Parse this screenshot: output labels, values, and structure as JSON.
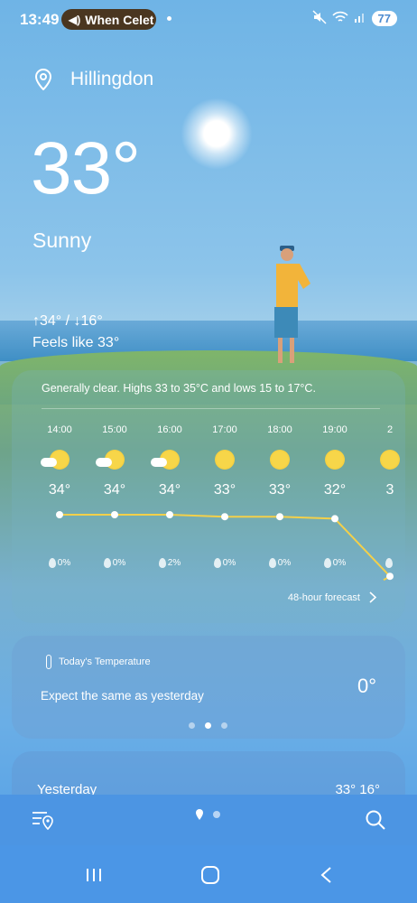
{
  "status": {
    "time": "13:49",
    "media_pill": "When Celet",
    "battery": "77"
  },
  "location": {
    "city": "Hillingdon"
  },
  "current": {
    "temp": "33°",
    "condition": "Sunny",
    "hilo": "↑34° / ↓16°",
    "feels": "Feels like 33°"
  },
  "hourly": {
    "summary": "Generally clear. Highs 33 to 35°C and lows 15 to 17°C.",
    "items": [
      {
        "time": "14:00",
        "temp": "34°",
        "precip": "0%",
        "icon": "partly-cloudy-icon"
      },
      {
        "time": "15:00",
        "temp": "34°",
        "precip": "0%",
        "icon": "partly-cloudy-icon"
      },
      {
        "time": "16:00",
        "temp": "34°",
        "precip": "2%",
        "icon": "partly-cloudy-icon"
      },
      {
        "time": "17:00",
        "temp": "33°",
        "precip": "0%",
        "icon": "sun-icon"
      },
      {
        "time": "18:00",
        "temp": "33°",
        "precip": "0%",
        "icon": "sun-icon"
      },
      {
        "time": "19:00",
        "temp": "32°",
        "precip": "0%",
        "icon": "sun-icon"
      },
      {
        "time": "2",
        "temp": "3",
        "precip": "",
        "icon": "sun-icon"
      }
    ],
    "forecast_link": "48-hour forecast"
  },
  "today_temp": {
    "title": "Today's Temperature",
    "message": "Expect the same as yesterday",
    "delta": "0°"
  },
  "yesterday": {
    "label": "Yesterday",
    "values": "33° 16°"
  },
  "colors": {
    "line": "#f3d04a",
    "sun": "#f7d649"
  }
}
